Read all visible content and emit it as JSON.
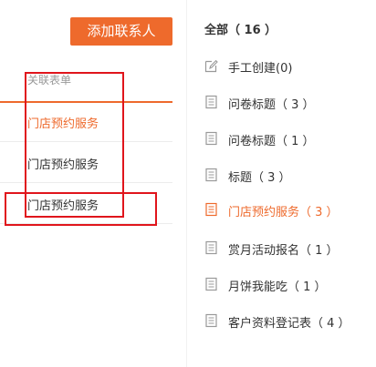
{
  "toolbar": {
    "add_contact_label": "添加联系人"
  },
  "table": {
    "header": "关联表单",
    "rows": [
      {
        "label": "门店预约服务",
        "active": true
      },
      {
        "label": "门店预约服务",
        "active": false
      },
      {
        "label": "门店预约服务",
        "active": false
      }
    ]
  },
  "filter_panel": {
    "all_label": "全部",
    "all_count": "（ 16 ）",
    "items": [
      {
        "icon": "pencil-icon",
        "label": "手工创建(0)"
      },
      {
        "icon": "document-icon",
        "label": "问卷标题（ 3 ）"
      },
      {
        "icon": "document-icon",
        "label": "问卷标题（ 1 ）"
      },
      {
        "icon": "document-icon",
        "label": "标题（ 3 ）"
      },
      {
        "icon": "document-icon",
        "label": "门店预约服务（ 3 ）",
        "active": true
      },
      {
        "icon": "document-icon",
        "label": "赏月活动报名（ 1 ）"
      },
      {
        "icon": "document-icon",
        "label": "月饼我能吃（ 1 ）"
      },
      {
        "icon": "document-icon",
        "label": "客户资料登记表（ 4 ）"
      }
    ]
  },
  "colors": {
    "accent": "#ee6a2c",
    "highlight_box": "#e0151c",
    "text": "#333333",
    "muted": "#999999"
  }
}
